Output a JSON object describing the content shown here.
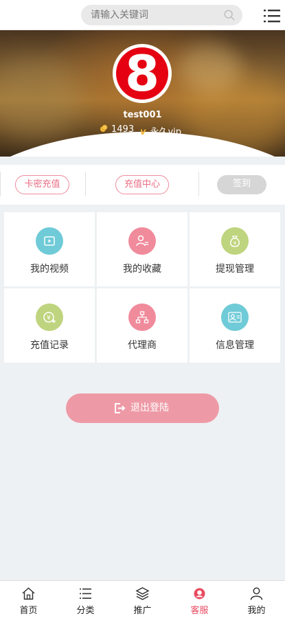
{
  "search": {
    "placeholder": "请输入关键词"
  },
  "profile": {
    "avatar_text": "8",
    "username": "test001",
    "coins": "1493",
    "vip_mark": "v",
    "vip_label": "永久vip"
  },
  "actions": {
    "card_recharge": "卡密充值",
    "recharge_center": "充值中心",
    "sign_in": "签到"
  },
  "grid": [
    {
      "label": "我的视频",
      "icon": "video-icon",
      "color": "#6fcbd7"
    },
    {
      "label": "我的收藏",
      "icon": "user-list-icon",
      "color": "#f08b9c"
    },
    {
      "label": "提现管理",
      "icon": "money-bag-icon",
      "color": "#bfd47e"
    },
    {
      "label": "充值记录",
      "icon": "yen-add-icon",
      "color": "#bfd47e"
    },
    {
      "label": "代理商",
      "icon": "hierarchy-icon",
      "color": "#f08b9c"
    },
    {
      "label": "信息管理",
      "icon": "user-info-icon",
      "color": "#6fcbd7"
    }
  ],
  "logout": {
    "label": "退出登陆"
  },
  "nav": [
    {
      "label": "首页",
      "icon": "home-icon"
    },
    {
      "label": "分类",
      "icon": "list-icon"
    },
    {
      "label": "推广",
      "icon": "layers-icon"
    },
    {
      "label": "客服",
      "icon": "service-icon",
      "active": true
    },
    {
      "label": "我的",
      "icon": "person-icon"
    }
  ],
  "colors": {
    "accent": "#ea6d84",
    "logout_bg": "#ee9aa6",
    "active_nav": "#e84a5f"
  }
}
